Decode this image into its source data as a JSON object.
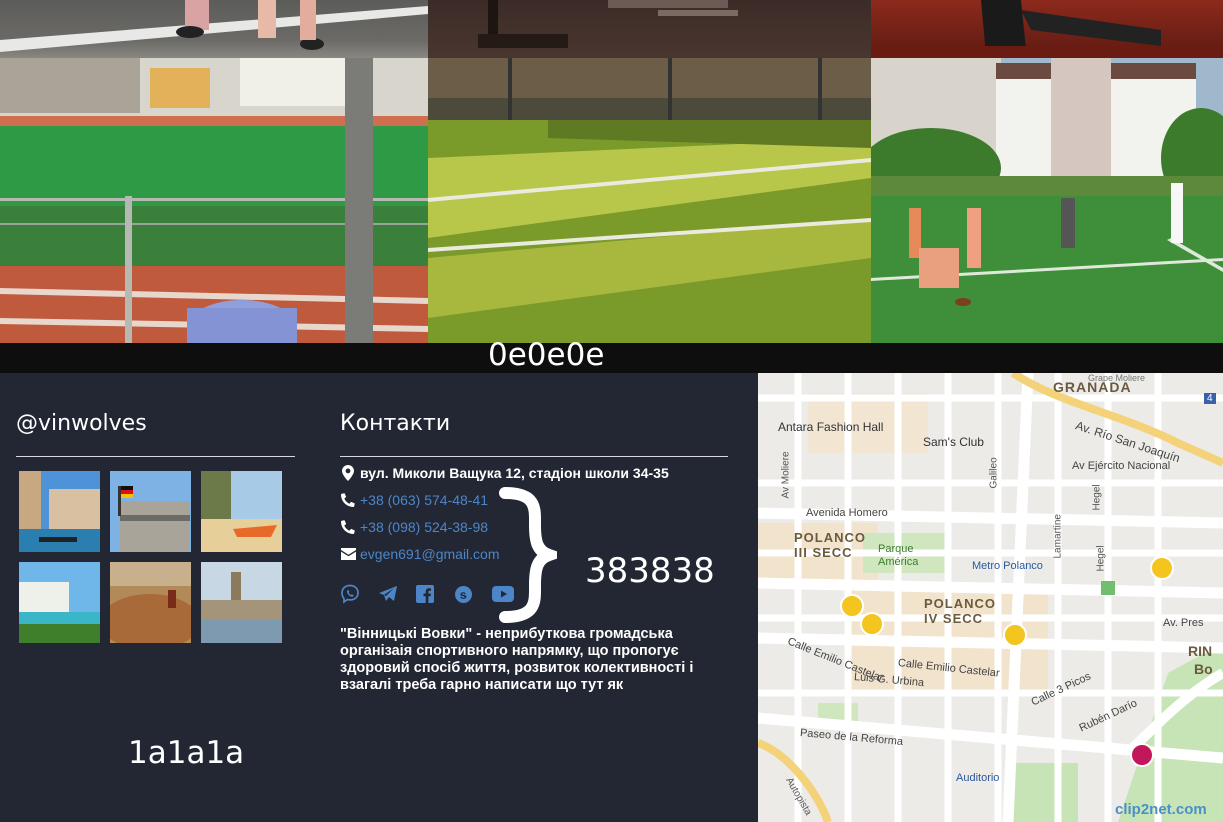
{
  "photos": {
    "tiles": [
      {
        "name": "photo-track-feet"
      },
      {
        "name": "photo-gym-floor"
      },
      {
        "name": "photo-athlete"
      },
      {
        "name": "photo-stadium-fence"
      },
      {
        "name": "photo-green-field"
      },
      {
        "name": "photo-football-players"
      }
    ]
  },
  "band": {
    "label": "0e0e0e"
  },
  "footer": {
    "background_label": "1a1a1a",
    "accent_label": "383838",
    "instagram": {
      "title": "@vinwolves",
      "thumbs": [
        "Venice",
        "Berlin",
        "Beach boat",
        "Resort",
        "Rock lookout",
        "London"
      ]
    },
    "contacts": {
      "title": "Контакти",
      "address": "вул. Миколи Ващука 12, стадіон школи 34-35",
      "phone1": "+38 (063) 574-48-41",
      "phone2": "+38 (098) 524-38-98",
      "email": "evgen691@gmail.com",
      "socials": [
        "viber-icon",
        "telegram-icon",
        "facebook-icon",
        "skype-icon",
        "youtube-icon"
      ],
      "about": "\"Вінницькі Вовки\" - неприбуткова громадська організаія спортивного напрямку, що пропогує здоровий спосіб життя, розвиток колективності і взагалі треба гарно написати що тут як"
    }
  },
  "map": {
    "labels": {
      "granada": "GRANADA",
      "antara": "Antara Fashion Hall",
      "sams": "Sam's Club",
      "rio": "Av. Río San Joaquín",
      "ejercito": "Av Ejército Nacional",
      "homero": "Avenida Homero",
      "moliere": "Av Moliere",
      "galileo": "Galileo",
      "lamartine": "Lamartine",
      "hegel": "Hegel",
      "hegel2": "Hegel",
      "polanco3": "POLANCO\nIII SECC",
      "parque": "Parque\nAmérica",
      "metro": "Metro Polanco",
      "polanco4": "POLANCO\nIV SECC",
      "presidentes": "Av. Pres",
      "castelar1": "Calle Emilio Castelar",
      "castelar2": "Calle Emilio Castelar",
      "urbina": "Luis G. Urbina",
      "picos": "Calle 3 Picos",
      "darío": "Rubén Darío",
      "reforma": "Paseo de la Reforma",
      "auditorio": "Auditorio",
      "autopista": "Autopista",
      "rin": "RIN",
      "bo": "Bo",
      "grape": "Grape Moliere",
      "num": "4",
      "watermark": "clip2net.com"
    }
  }
}
